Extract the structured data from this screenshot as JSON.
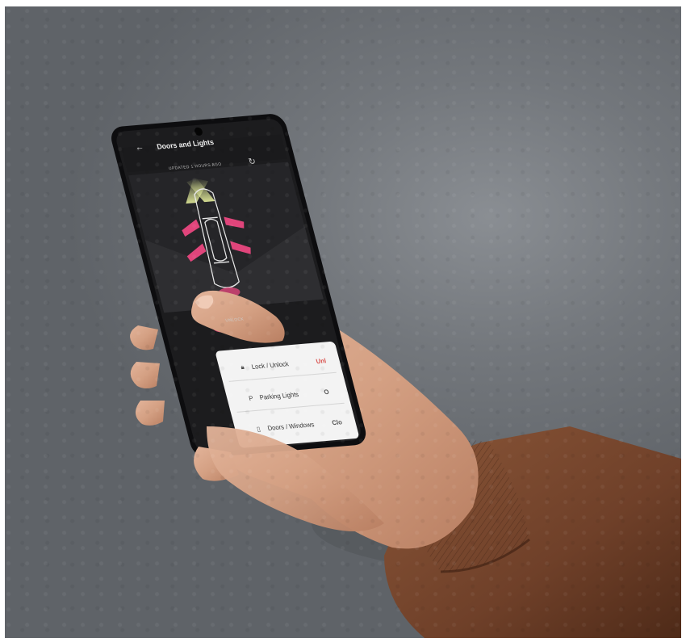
{
  "app": {
    "screen_title": "Doors and Lights",
    "updated_text": "UPDATED 1 HOURS AGO",
    "unlock_label": "UNLOCK",
    "rows": [
      {
        "label": "Lock / Unlock",
        "value": "Unl"
      },
      {
        "label": "Parking Lights",
        "value": "O"
      },
      {
        "label": "Doors / Windows",
        "value": "Clo"
      }
    ]
  },
  "icons": {
    "back": "back-arrow-icon",
    "refresh": "refresh-icon",
    "lock": "lock-icon",
    "parking": "parking-lights-icon",
    "door": "door-icon"
  },
  "colors": {
    "accent": "#e0457b",
    "headlight": "#d8e39a",
    "phone_bg": "#1c1c1e",
    "sleeve": "#7a4a30"
  }
}
